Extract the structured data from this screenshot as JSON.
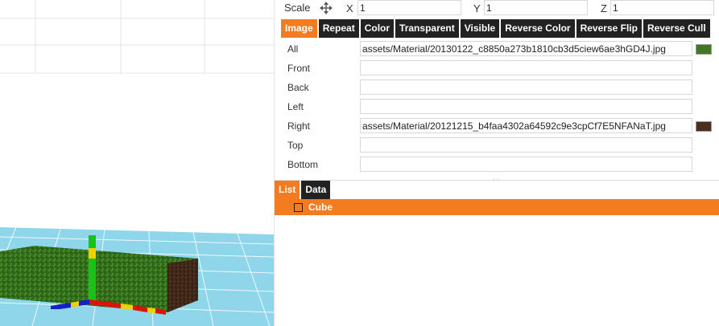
{
  "transform": {
    "scale_label": "Scale",
    "move_icon": "move-arrows-icon",
    "x_label": "X",
    "x_value": "1",
    "y_label": "Y",
    "y_value": "1",
    "z_label": "Z",
    "z_value": "1"
  },
  "material_tabs": [
    {
      "label": "Image",
      "active": true
    },
    {
      "label": "Repeat",
      "active": false
    },
    {
      "label": "Color",
      "active": false
    },
    {
      "label": "Transparent",
      "active": false
    },
    {
      "label": "Visible",
      "active": false
    },
    {
      "label": "Reverse Color",
      "active": false
    },
    {
      "label": "Reverse Flip",
      "active": false
    },
    {
      "label": "Reverse Cull",
      "active": false
    }
  ],
  "textures": [
    {
      "label": "All",
      "value": "assets/Material/20130122_c8850a273b1810cb3d5ciew6ae3hGD4J.jpg",
      "swatch": "#3f7a23"
    },
    {
      "label": "Front",
      "value": "",
      "swatch": ""
    },
    {
      "label": "Back",
      "value": "",
      "swatch": ""
    },
    {
      "label": "Left",
      "value": "",
      "swatch": ""
    },
    {
      "label": "Right",
      "value": "assets/Material/20121215_b4faa4302a64592c9e3cpCf7E5NFANaT.jpg",
      "swatch": "#4a2e1e"
    },
    {
      "label": "Top",
      "value": "",
      "swatch": ""
    },
    {
      "label": "Bottom",
      "value": "",
      "swatch": ""
    }
  ],
  "bottom_tabs": [
    {
      "label": "List",
      "active": true
    },
    {
      "label": "Data",
      "active": false
    }
  ],
  "object_list": [
    {
      "label": "Cube",
      "checked": false
    }
  ],
  "colors": {
    "accent": "#f47b20",
    "tab_bg": "#222222",
    "ground": "#7ccfe6",
    "grass": "#3f7a23",
    "bark": "#4a2e1e",
    "axis_red": "#d9140b",
    "axis_green": "#19c219",
    "axis_blue": "#1420c8",
    "axis_yellow": "#f0d000"
  }
}
